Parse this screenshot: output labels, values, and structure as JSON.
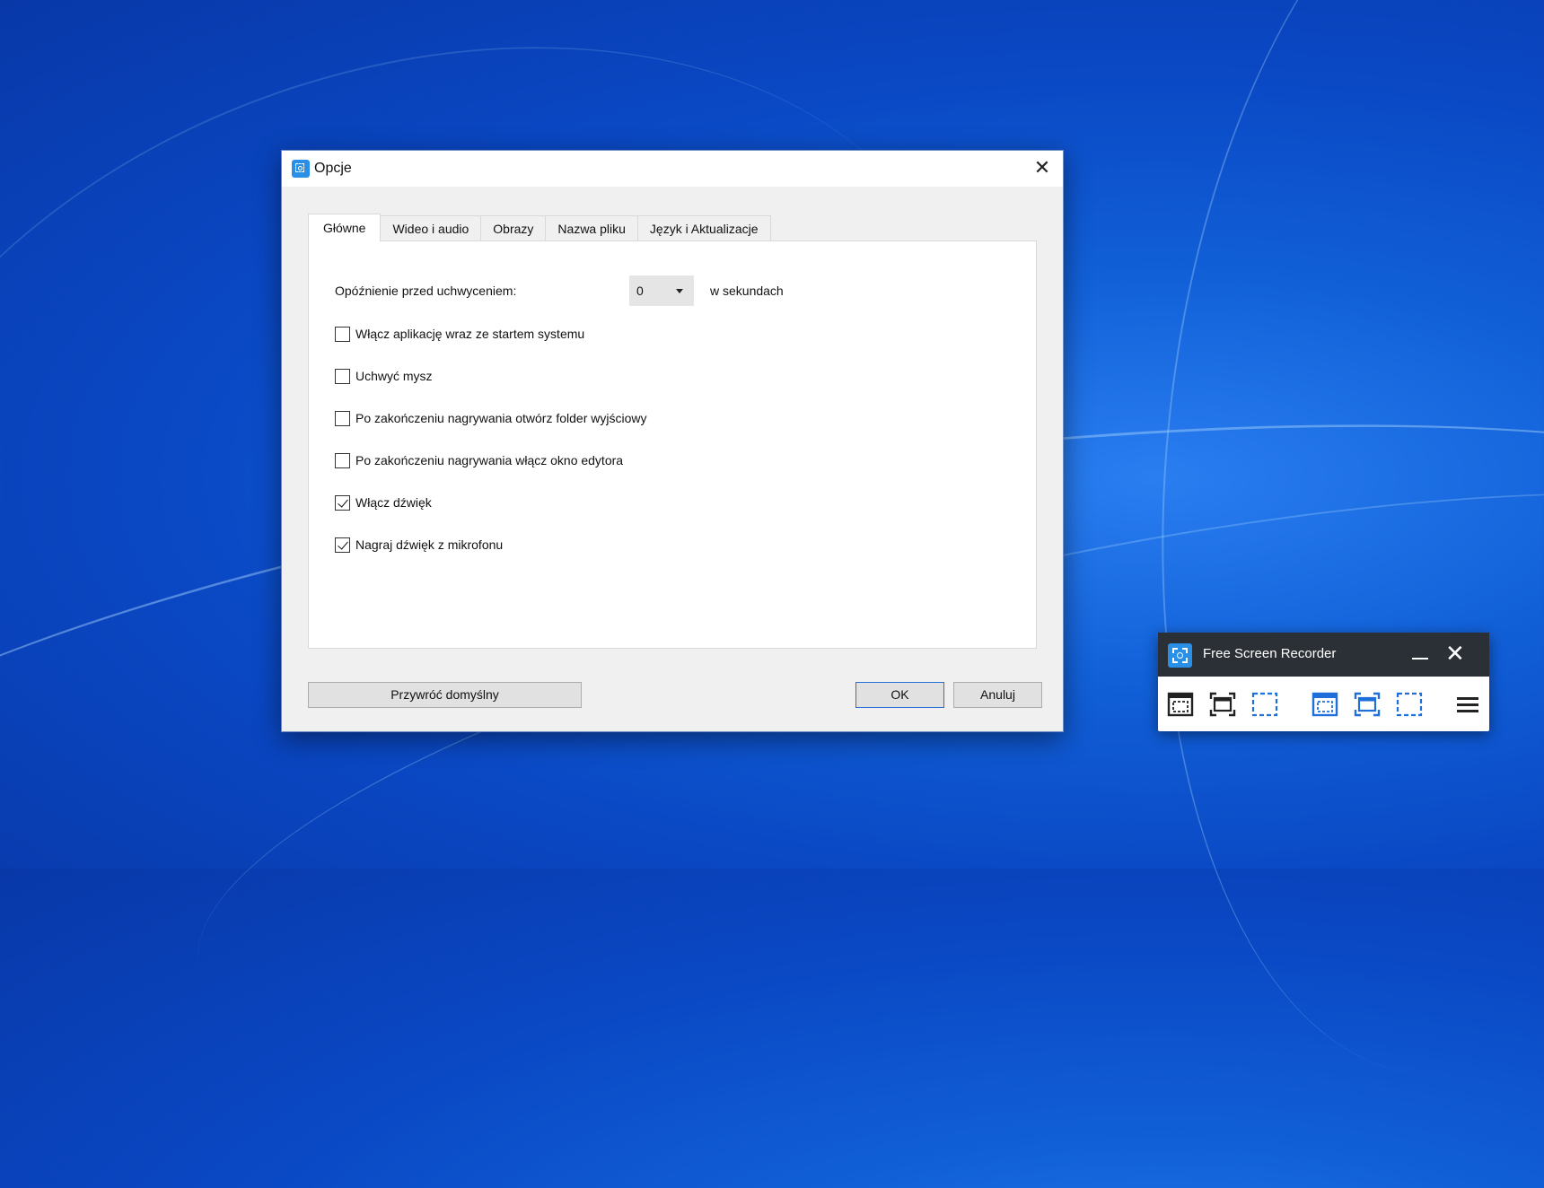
{
  "dialog": {
    "title": "Opcje",
    "close_icon": "close-icon",
    "tabs": [
      {
        "label": "Główne",
        "active": true
      },
      {
        "label": "Wideo i audio",
        "active": false
      },
      {
        "label": "Obrazy",
        "active": false
      },
      {
        "label": "Nazwa pliku",
        "active": false
      },
      {
        "label": "Język i Aktualizacje",
        "active": false
      }
    ],
    "delay": {
      "label": "Opóźnienie przed uchwyceniem:",
      "value": "0",
      "unit": "w sekundach"
    },
    "options": [
      {
        "label": "Włącz aplikację wraz ze startem systemu",
        "checked": false
      },
      {
        "label": "Uchwyć mysz",
        "checked": false
      },
      {
        "label": "Po zakończeniu nagrywania otwórz folder wyjściowy",
        "checked": false
      },
      {
        "label": "Po zakończeniu nagrywania włącz okno edytora",
        "checked": false
      },
      {
        "label": "Włącz dźwięk",
        "checked": true
      },
      {
        "label": "Nagraj dźwięk z mikrofonu",
        "checked": true
      }
    ],
    "buttons": {
      "restore": "Przywróć domyślny",
      "ok": "OK",
      "cancel": "Anuluj"
    }
  },
  "recorder": {
    "title": "Free Screen Recorder",
    "tools": [
      {
        "icon": "screenshot-fullscreen-icon",
        "color": "#222222"
      },
      {
        "icon": "screenshot-window-icon",
        "color": "#222222"
      },
      {
        "icon": "screenshot-region-icon",
        "color": "#1e6fd9"
      },
      {
        "icon": "record-fullscreen-icon",
        "color": "#1e6fd9"
      },
      {
        "icon": "record-window-icon",
        "color": "#1e6fd9"
      },
      {
        "icon": "record-region-icon",
        "color": "#1e6fd9"
      },
      {
        "icon": "menu-icon",
        "color": "#222222"
      }
    ]
  },
  "colors": {
    "desktop": "#0a48c4",
    "accent": "#2a8fe6",
    "recorder_titlebar": "#2b2f36"
  }
}
